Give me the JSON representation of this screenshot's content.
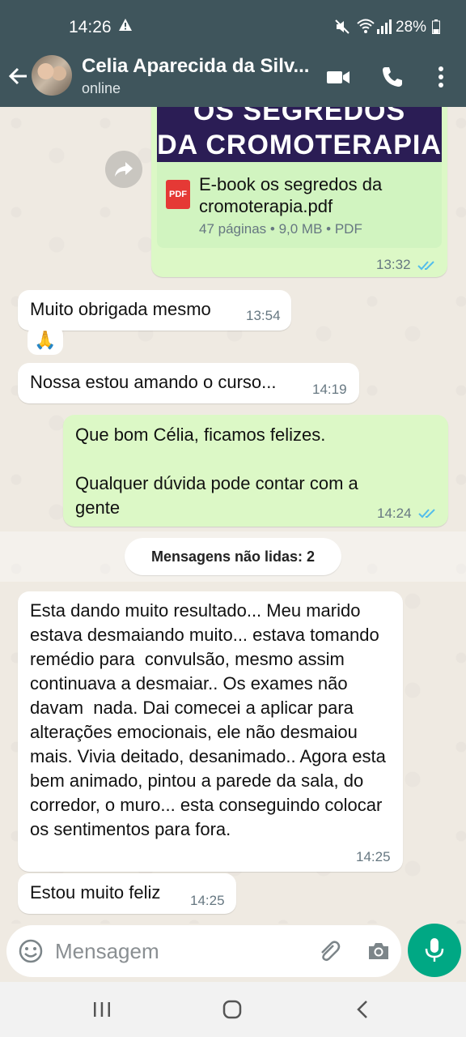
{
  "status_bar": {
    "time": "14:26",
    "battery": "28%"
  },
  "header": {
    "contact_name": "Celia Aparecida da Silv...",
    "presence": "online"
  },
  "document": {
    "preview_line1": "OS SEGREDOS",
    "preview_line2": "DA CROMOTERAPIA",
    "file_icon_text": "PDF",
    "file_name": "E-book os segredos da cromoterapia.pdf",
    "file_info": "47 páginas • 9,0 MB • PDF",
    "time": "13:32"
  },
  "messages": [
    {
      "text": "Muito obrigada mesmo",
      "time": "13:54",
      "direction": "in"
    },
    {
      "text": "🙏",
      "direction": "in"
    },
    {
      "text": "Nossa estou amando o curso...",
      "time": "14:19",
      "direction": "in"
    },
    {
      "text": "Que bom Célia, ficamos felizes.\n\nQualquer dúvida pode contar com a gente",
      "time": "14:24",
      "direction": "out"
    },
    {
      "text": "Esta dando muito resultado... Meu marido estava desmaiando muito... estava tomando remédio para  convulsão, mesmo assim continuava a desmaiar.. Os exames não davam  nada. Dai comecei a aplicar para alterações emocionais, ele não desmaiou mais. Vivia deitado, desanimado.. Agora esta bem animado, pintou a parede da sala, do corredor, o muro... esta conseguindo colocar os sentimentos para fora.",
      "time": "14:25",
      "direction": "in"
    },
    {
      "text": "Estou muito feliz",
      "time": "14:25",
      "direction": "in"
    }
  ],
  "unread_divider": "Mensagens não lidas: 2",
  "composer": {
    "placeholder": "Mensagem"
  },
  "colors": {
    "header": "#3f555c",
    "outgoing_bubble": "#dcf8c6",
    "incoming_bubble": "#ffffff",
    "accent": "#00a884",
    "read_ticks": "#53bdeb"
  }
}
